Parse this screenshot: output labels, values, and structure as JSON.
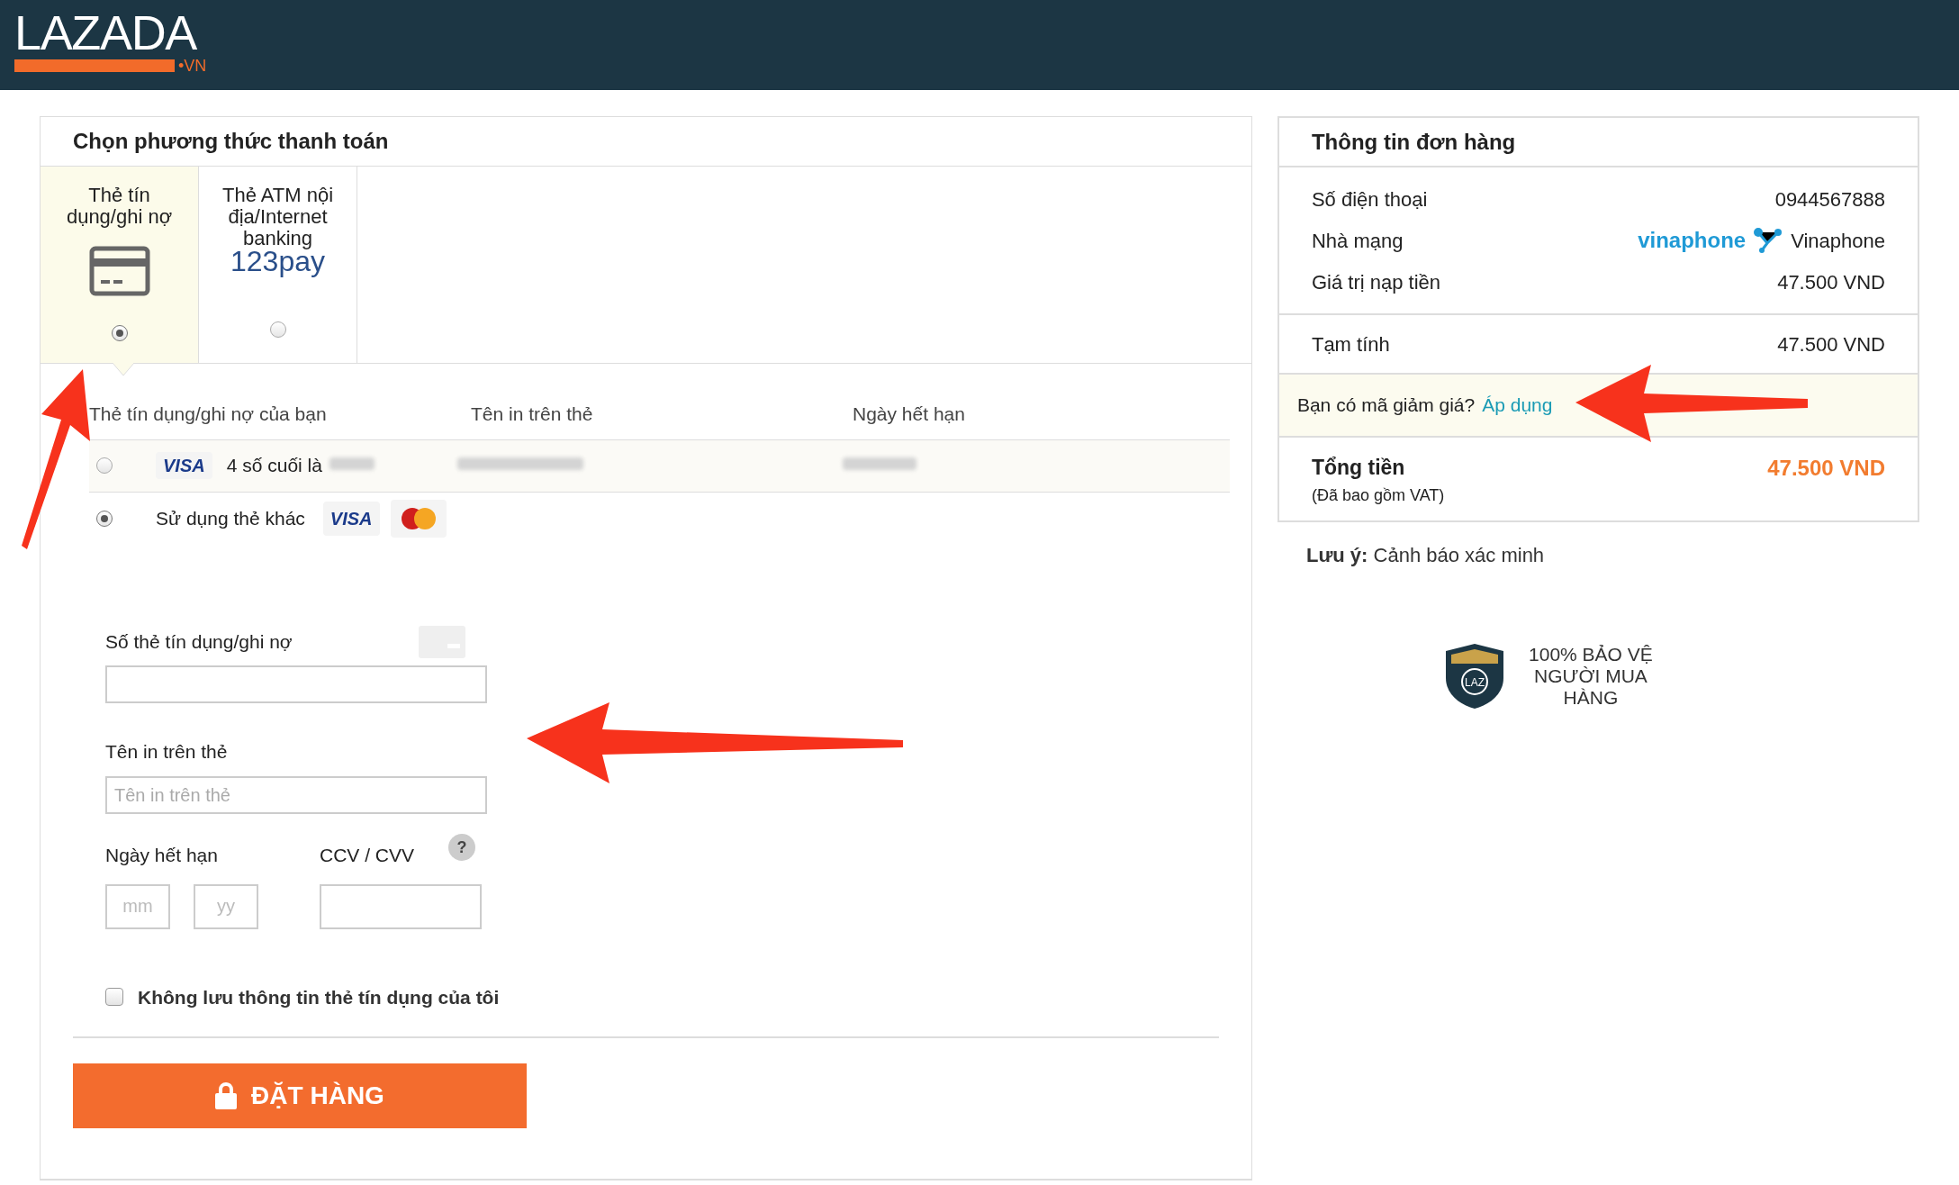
{
  "header": {
    "logo": {
      "brand": "LAZADA",
      "suffix": "•VN"
    }
  },
  "payment": {
    "title": "Chọn phương thức thanh toán",
    "methods": [
      {
        "label": "Thẻ tín dụng/ghi nợ",
        "kind": "card",
        "selected": true
      },
      {
        "label": "Thẻ ATM nội địa/Internet banking",
        "kind": "bank",
        "logo": "123pay",
        "selected": false
      }
    ],
    "columns": [
      "Thẻ tín dụng/ghi nợ của bạn",
      "Tên in trên thẻ",
      "Ngày hết hạn"
    ],
    "cards": [
      {
        "kind": "saved",
        "selected": false,
        "brand": "VISA",
        "label": "4 số cuối là"
      },
      {
        "kind": "other",
        "selected": true,
        "brand": "VISA",
        "label": "Sử dụng thẻ khác"
      }
    ],
    "form": {
      "number_label": "Số thẻ tín dụng/ghi nợ",
      "name_label": "Tên in trên thẻ",
      "name_placeholder": "Tên in trên thẻ",
      "expiry_label": "Ngày hết hạn",
      "month_placeholder": "mm",
      "year_placeholder": "yy",
      "cvv_label": "CCV / CVV",
      "help": "?"
    },
    "dont_save": {
      "label": "Không lưu thông tin thẻ tín dụng của tôi",
      "checked": false
    },
    "submit": "ĐẶT HÀNG"
  },
  "order": {
    "title": "Thông tin đơn hàng",
    "rows": [
      {
        "label": "Số điện thoại",
        "value": "0944567888"
      },
      {
        "label": "Nhà mạng",
        "logo": "vinaphone",
        "value": "Vinaphone"
      },
      {
        "label": "Giá trị nạp tiền",
        "value": "47.500 VND"
      }
    ],
    "subtotal": {
      "label": "Tạm tính",
      "value": "47.500 VND"
    },
    "promo": {
      "text": "Bạn có mã giảm giá?",
      "link": "Áp dụng"
    },
    "total": {
      "label": "Tổng tiền",
      "note": "(Đã bao gồm VAT)",
      "value": "47.500 VND"
    },
    "notice": {
      "label": "Lưu ý:",
      "text": "Cảnh báo xác minh"
    },
    "guarantee": {
      "badge": "LAZ",
      "text": "100% BẢO VỆ NGƯỜI MUA HÀNG"
    }
  }
}
